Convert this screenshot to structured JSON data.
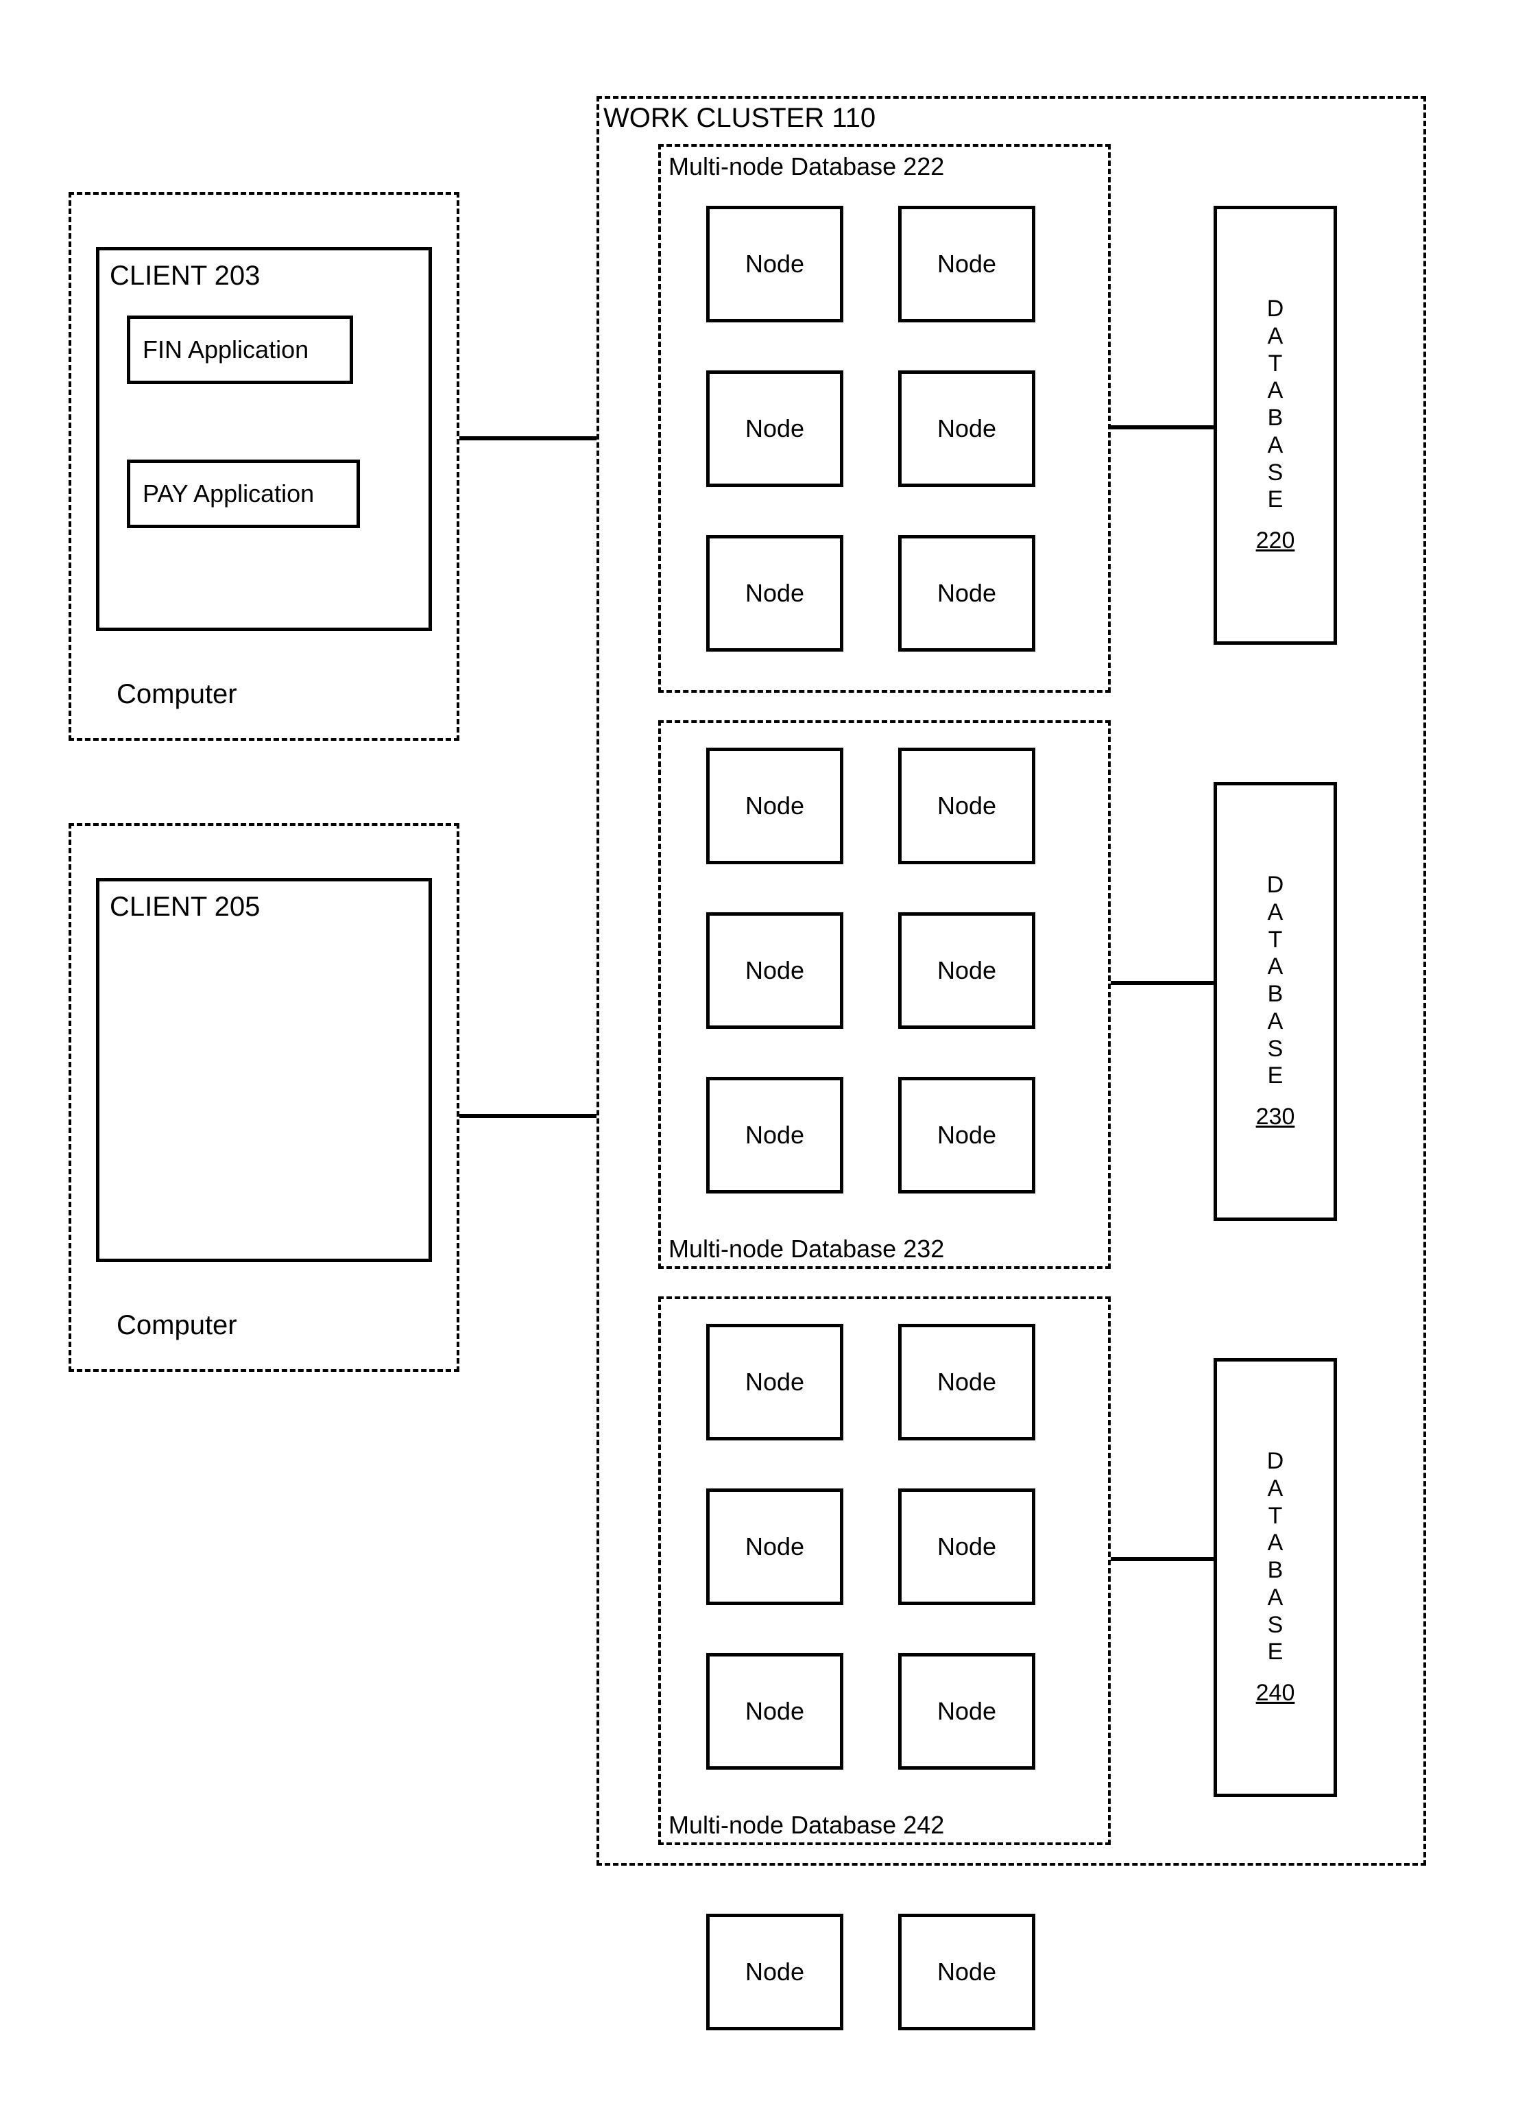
{
  "cluster": {
    "title": "WORK CLUSTER 110",
    "groups": [
      {
        "title": "Multi-node Database 222",
        "nodes": [
          "Node",
          "Node",
          "Node",
          "Node",
          "Node",
          "Node"
        ],
        "db_label": "DATABASE",
        "db_num": "220"
      },
      {
        "title": "Multi-node Database 232",
        "nodes": [
          "Node",
          "Node",
          "Node",
          "Node",
          "Node",
          "Node"
        ],
        "db_label": "DATABASE",
        "db_num": "230"
      },
      {
        "title": "Multi-node Database 242",
        "nodes": [
          "Node",
          "Node",
          "Node",
          "Node",
          "Node",
          "Node"
        ],
        "db_label": "DATABASE",
        "db_num": "240"
      }
    ]
  },
  "clients": [
    {
      "title": "CLIENT 203",
      "footer": "Computer",
      "apps": [
        "FIN Application",
        "PAY Application"
      ]
    },
    {
      "title": "CLIENT 205",
      "footer": "Computer",
      "apps": []
    }
  ],
  "pool_nodes": [
    "Node",
    "Node"
  ]
}
